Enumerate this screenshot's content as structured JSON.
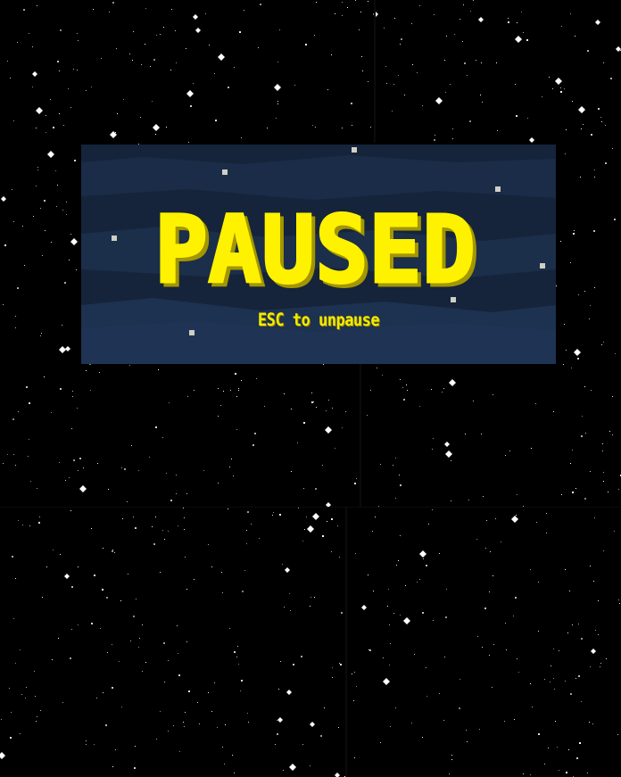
{
  "pause_screen": {
    "title": "PAUSED",
    "hint": "ESC to unpause"
  },
  "colors": {
    "background": "#000000",
    "panel": "#17273f",
    "panel_light": "#1d3150",
    "title_yellow": "#fff200",
    "title_shadow": "#a39600",
    "star": "#ffffff"
  }
}
